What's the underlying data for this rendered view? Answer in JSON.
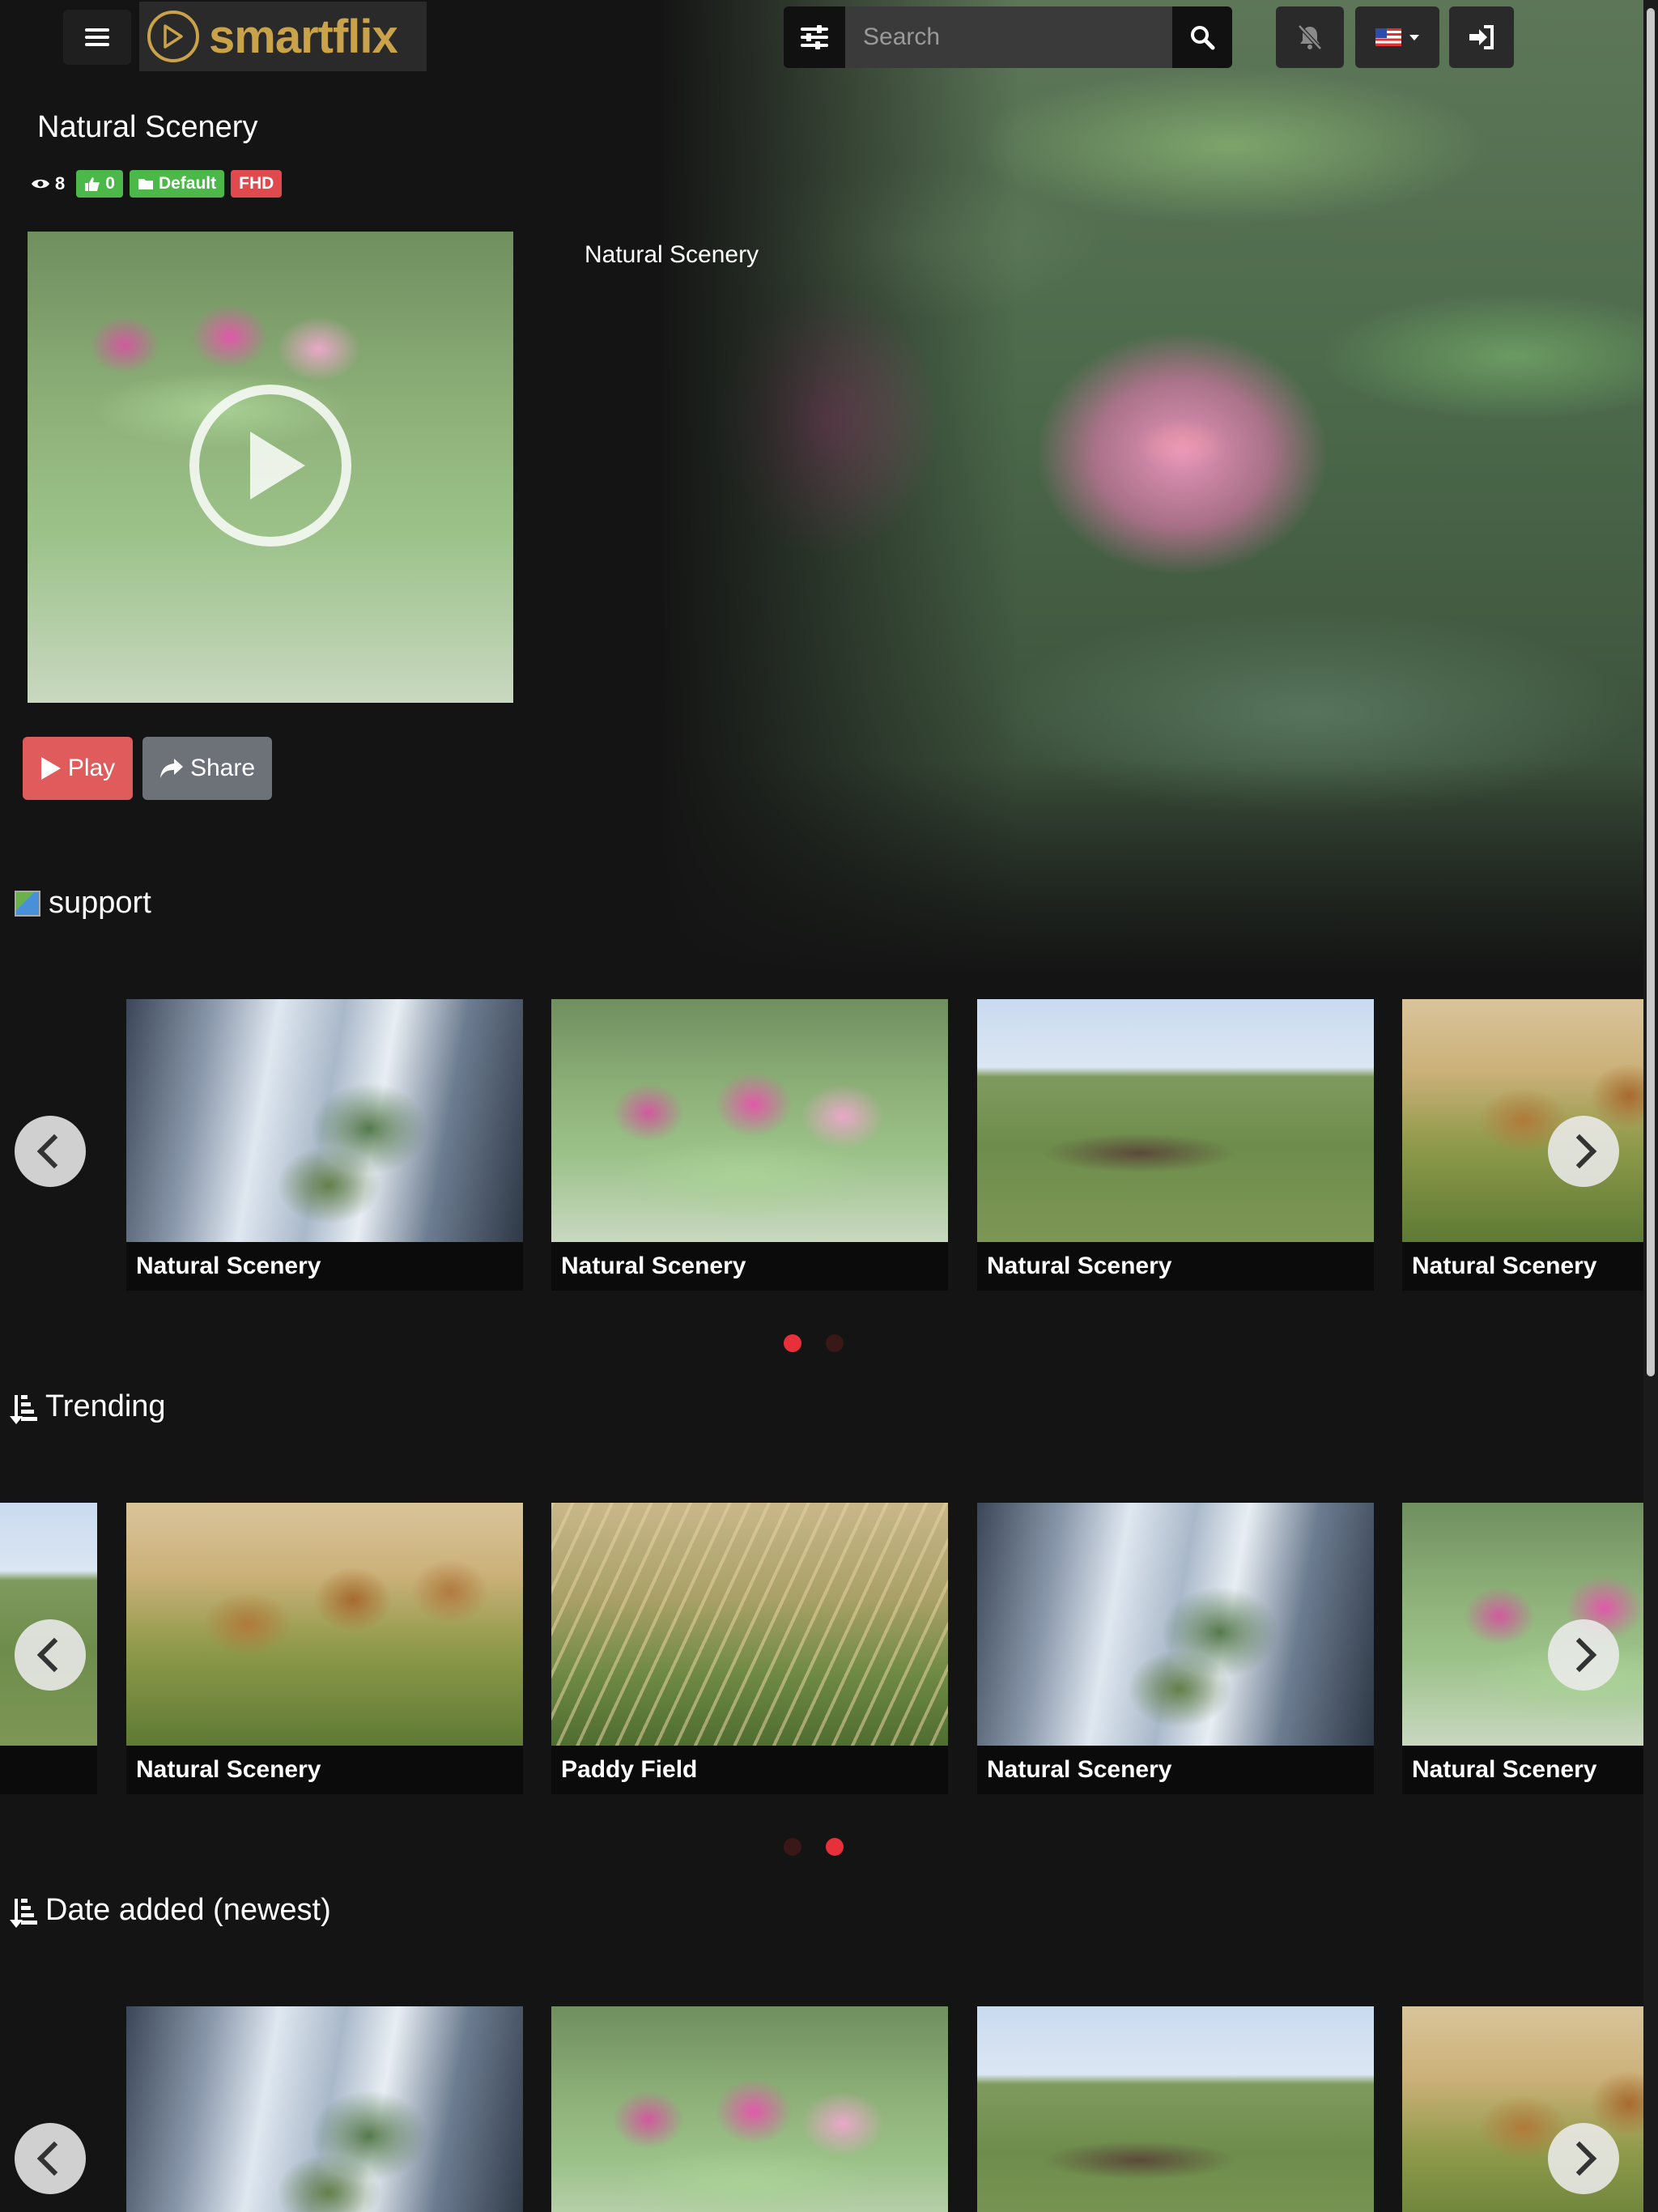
{
  "app": {
    "name": "smartflix"
  },
  "nav": {
    "search_placeholder": "Search"
  },
  "movie": {
    "title": "Natural Scenery",
    "views": "8",
    "likes": "0",
    "category": "Default",
    "quality": "FHD",
    "side_title": "Natural Scenery",
    "play_label": "Play",
    "share_label": "Share"
  },
  "sections": [
    {
      "title": "support",
      "cards": [
        {
          "label": "Natural Scenery",
          "thumb": "waterfall"
        },
        {
          "label": "Natural Scenery",
          "thumb": "lily"
        },
        {
          "label": "Natural Scenery",
          "thumb": "shepherd"
        },
        {
          "label": "Natural Scenery",
          "thumb": "lions"
        }
      ],
      "active_dot": 0
    },
    {
      "title": "Trending",
      "cards": [
        {
          "label": "Natural Scenery",
          "thumb": "lions"
        },
        {
          "label": "Paddy Field",
          "thumb": "paddy"
        },
        {
          "label": "Natural Scenery",
          "thumb": "waterfall"
        },
        {
          "label": "Natural Scenery",
          "thumb": "lily"
        }
      ],
      "active_dot": 1
    },
    {
      "title": "Date added (newest)",
      "cards": [
        {
          "thumb": "waterfall"
        },
        {
          "thumb": "lily"
        },
        {
          "thumb": "shepherd"
        },
        {
          "thumb": "lions"
        }
      ]
    }
  ],
  "colors": {
    "brand_gold": "#c9a24a",
    "accent_red": "#e8303a",
    "badge_green": "#4cb84a",
    "badge_red": "#e04a4f"
  }
}
